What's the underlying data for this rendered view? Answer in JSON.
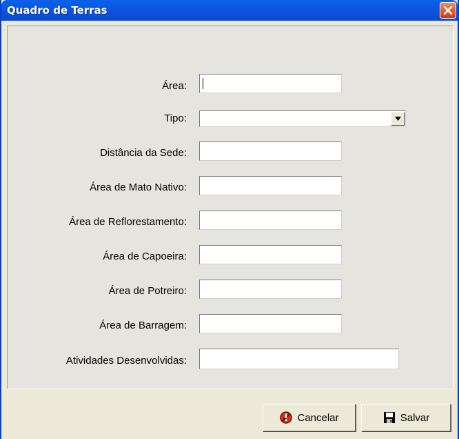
{
  "window": {
    "title": "Quadro de Terras"
  },
  "form": {
    "area_label": "Área:",
    "area_value": "",
    "tipo_label": "Tipo:",
    "tipo_value": "",
    "distancia_label": "Distância da Sede:",
    "distancia_value": "",
    "mato_label": "Área de Mato Nativo:",
    "mato_value": "",
    "reflorestamento_label": "Área de Reflorestamento:",
    "reflorestamento_value": "",
    "capoeira_label": "Área de Capoeira:",
    "capoeira_value": "",
    "potreiro_label": "Área de Potreiro:",
    "potreiro_value": "",
    "barragem_label": "Área de Barragem:",
    "barragem_value": "",
    "atividades_label": "Atividades Desenvolvidas:",
    "atividades_value": ""
  },
  "buttons": {
    "cancel_label": "Cancelar",
    "save_label": "Salvar"
  },
  "icons": {
    "close": "close-icon",
    "cancel": "cancel-icon",
    "save": "floppy-disk-icon",
    "dropdown": "chevron-down-icon"
  },
  "colors": {
    "titlebar": "#0a56e0",
    "close_button": "#e1542c",
    "window_bg": "#ece9d8"
  }
}
